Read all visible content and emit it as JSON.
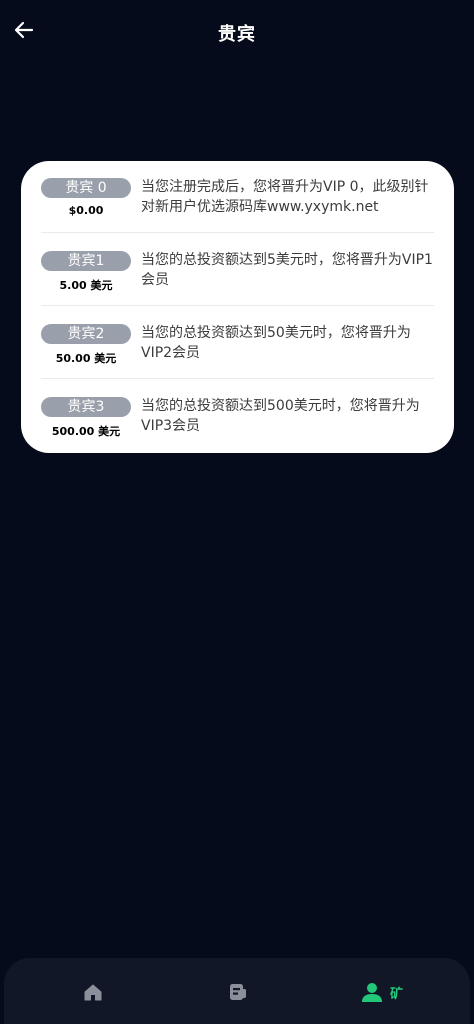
{
  "header": {
    "title": "贵宾",
    "back_icon": "arrow-left-icon"
  },
  "tiers": [
    {
      "badge": "贵宾 0",
      "amount": "$0.00",
      "description": "当您注册完成后，您将晋升为VIP 0，此级别针对新用户优选源码库www.yxymk.net"
    },
    {
      "badge": "贵宾1",
      "amount": "5.00 美元",
      "description": "当您的总投资额达到5美元时，您将晋升为VIP1会员"
    },
    {
      "badge": "贵宾2",
      "amount": "50.00 美元",
      "description": "当您的总投资额达到50美元时，您将晋升为VIP2会员"
    },
    {
      "badge": "贵宾3",
      "amount": "500.00 美元",
      "description": "当您的总投资额达到500美元时，您将晋升为VIP3会员"
    }
  ],
  "nav": {
    "items": [
      {
        "icon": "home-icon",
        "active": false
      },
      {
        "icon": "wallet-icon",
        "active": false
      },
      {
        "icon": "user-icon",
        "active": true,
        "label": "矿"
      }
    ]
  },
  "colors": {
    "background": "#060b1b",
    "card": "#ffffff",
    "badge": "#9aa0ab",
    "nav_bg": "#111726",
    "nav_inactive": "#8a8f99",
    "nav_active": "#23c77a"
  }
}
